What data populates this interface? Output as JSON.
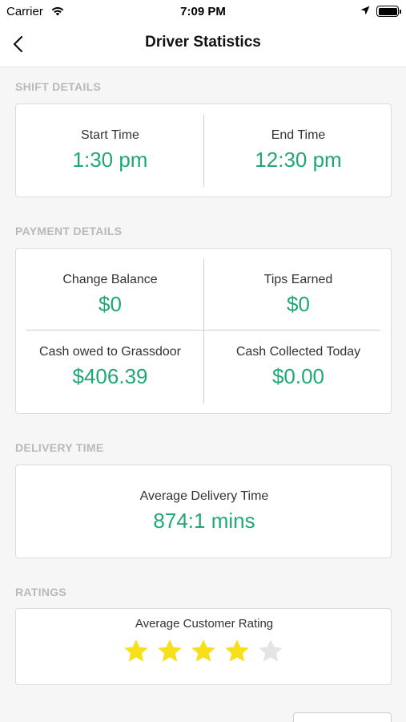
{
  "status": {
    "carrier": "Carrier",
    "time": "7:09 PM"
  },
  "header": {
    "title": "Driver Statistics"
  },
  "shift": {
    "label": "SHIFT DETAILS",
    "start_label": "Start Time",
    "start_value": "1:30 pm",
    "end_label": "End Time",
    "end_value": "12:30 pm"
  },
  "payment": {
    "label": "PAYMENT DETAILS",
    "change_label": "Change Balance",
    "change_value": "$0",
    "tips_label": "Tips Earned",
    "tips_value": "$0",
    "owed_label": "Cash owed to Grassdoor",
    "owed_value": "$406.39",
    "collected_label": "Cash Collected Today",
    "collected_value": "$0.00"
  },
  "delivery": {
    "label": "DELIVERY TIME",
    "avg_label": "Average Delivery Time",
    "avg_value": "874:1 mins"
  },
  "ratings": {
    "label": "RATINGS",
    "avg_label": "Average Customer Rating",
    "rating": 4,
    "max": 5
  },
  "colors": {
    "accent": "#1fa876",
    "star_filled": "#f7e01a",
    "star_empty": "#e4e4e4"
  }
}
